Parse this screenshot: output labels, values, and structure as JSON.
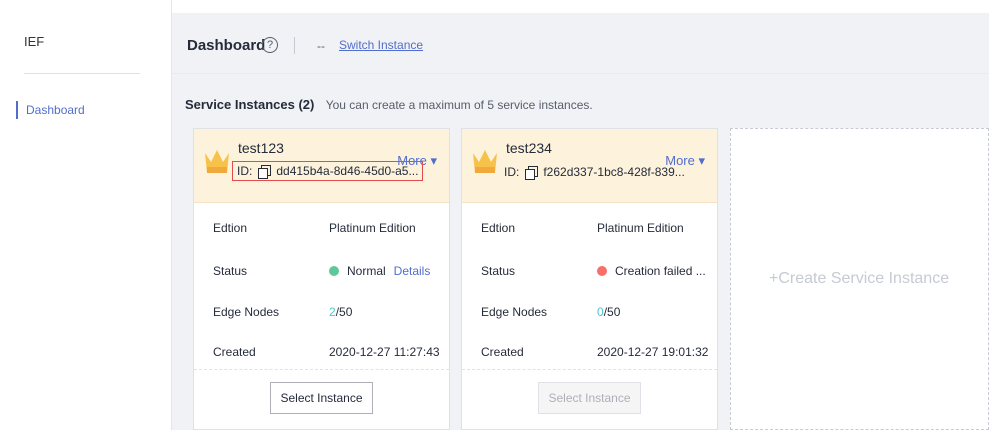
{
  "sidebar": {
    "title": "IEF",
    "items": [
      {
        "label": "Dashboard"
      }
    ]
  },
  "header": {
    "title": "Dashboard",
    "help_icon": "?",
    "instance_placeholder": "--",
    "switch_label": "Switch Instance"
  },
  "section": {
    "title": "Service Instances (2)",
    "hint": "You can create a maximum of 5 service instances."
  },
  "labels": {
    "edition": "Edtion",
    "status": "Status",
    "edge_nodes": "Edge Nodes",
    "created": "Created",
    "id_prefix": "ID:",
    "more": "More ▾",
    "select": "Select Instance",
    "details": "Details",
    "nodes_sep": "/"
  },
  "instances": [
    {
      "name": "test123",
      "id": "dd415b4a-8d46-45d0-a5...",
      "edition": "Platinum Edition",
      "status": "Normal",
      "status_color": "#5ec79b",
      "nodes_used": "2",
      "nodes_total": "50",
      "created": "2020-12-27 11:27:43"
    },
    {
      "name": "test234",
      "id": "f262d337-1bc8-428f-839...",
      "edition": "Platinum Edition",
      "status": "Creation failed ...",
      "status_color": "#f66f6a",
      "nodes_used": "0",
      "nodes_total": "50",
      "created": "2020-12-27 19:01:32"
    }
  ],
  "create": {
    "label": "+Create Service Instance"
  },
  "colors": {
    "accent": "#526ecc",
    "card_header_bg": "#fdf3dc",
    "highlight_box": "#e34c4c"
  }
}
